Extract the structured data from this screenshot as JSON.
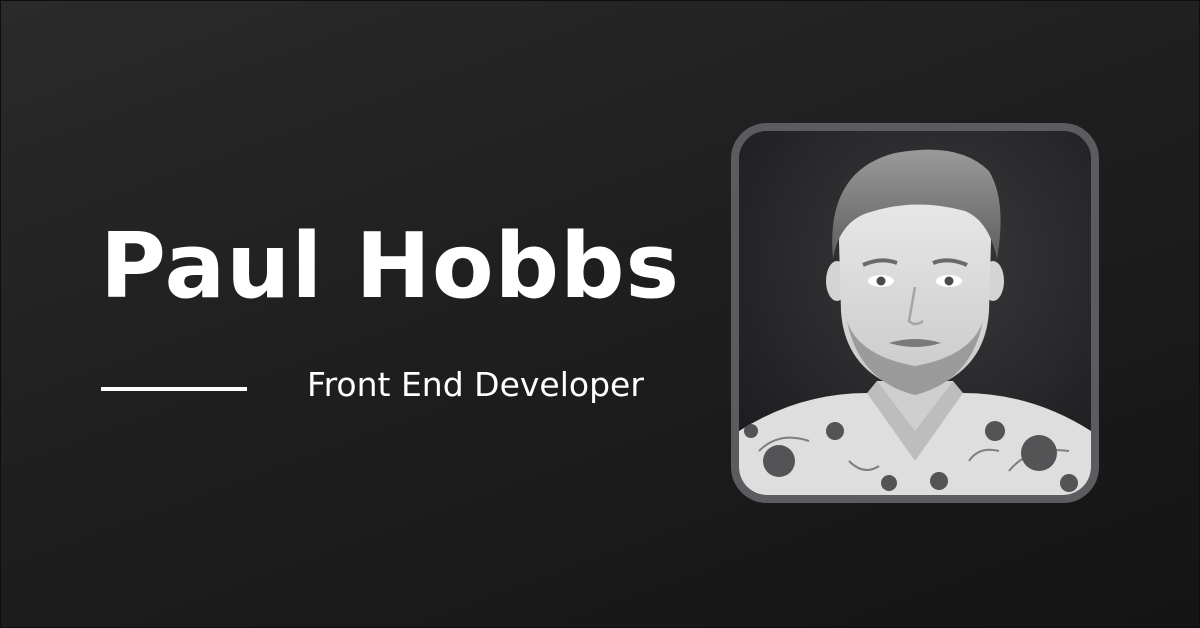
{
  "profile": {
    "name": "Paul Hobbs",
    "role": "Front End Developer"
  },
  "colors": {
    "background_top": "#2a2a2a",
    "background_bottom": "#141414",
    "text": "#ffffff",
    "photo_border": "#5c5c60"
  },
  "photo": {
    "icon": "portrait-photo",
    "style": "grayscale headshot with floral shirt"
  }
}
